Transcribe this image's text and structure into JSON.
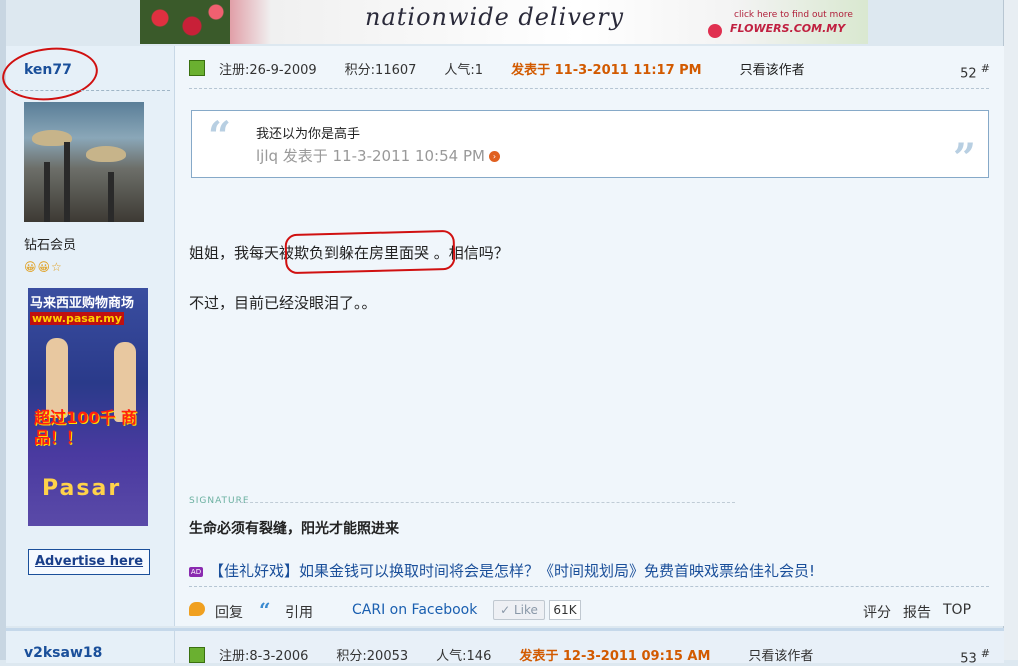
{
  "banner": {
    "headline": "nationwide delivery",
    "subline": "click here to find out more",
    "brand": "FLOWERS.COM.MY"
  },
  "post": {
    "author": "ken77",
    "rank": "钻石会员",
    "stars": "😀😀☆",
    "meta": {
      "registered": "注册:26-9-2009",
      "points": "积分:11607",
      "popularity": "人气:1",
      "posted_at": "发表于 11-3-2011 11:17 PM",
      "only_author": "只看该作者"
    },
    "floor": "52",
    "floor_mark": "#",
    "quote": {
      "text": "我还以为你是高手",
      "meta": "ljlq 发表于 11-3-2011 10:54 PM"
    },
    "message_line1": "姐姐，我每天被欺负到躲在房里面哭 。相信吗？",
    "message_line2": "不过，目前已经没眼泪了。。",
    "signature_label": "SIGNATURE",
    "signature": "生命必须有裂缝，阳光才能照进来",
    "promo": "【佳礼好戏】如果金钱可以换取时间将会是怎样？《时间规划局》免费首映戏票给佳礼会员!",
    "actions": {
      "reply": "回复",
      "quote": "引用",
      "facebook": "CARI on Facebook",
      "like": "Like",
      "like_count": "61K",
      "rate": "评分",
      "report": "报告",
      "top": "TOP"
    }
  },
  "side_ad": {
    "title": "马来西亚购物商场",
    "url": "www.pasar.my",
    "offer": "超过100千 商品！！",
    "logo": "Pasar",
    "advertise": "Advertise here"
  },
  "next_post": {
    "author": "v2ksaw18",
    "registered": "注册:8-3-2006",
    "points": "积分:20053",
    "popularity": "人气:146",
    "posted_at": "发表于 12-3-2011 09:15 AM",
    "only_author": "只看该作者",
    "floor": "53",
    "floor_mark": "#"
  },
  "colors": {
    "accent": "#1a4f9a",
    "timestamp": "#d25a00",
    "annotation": "#d01010"
  }
}
